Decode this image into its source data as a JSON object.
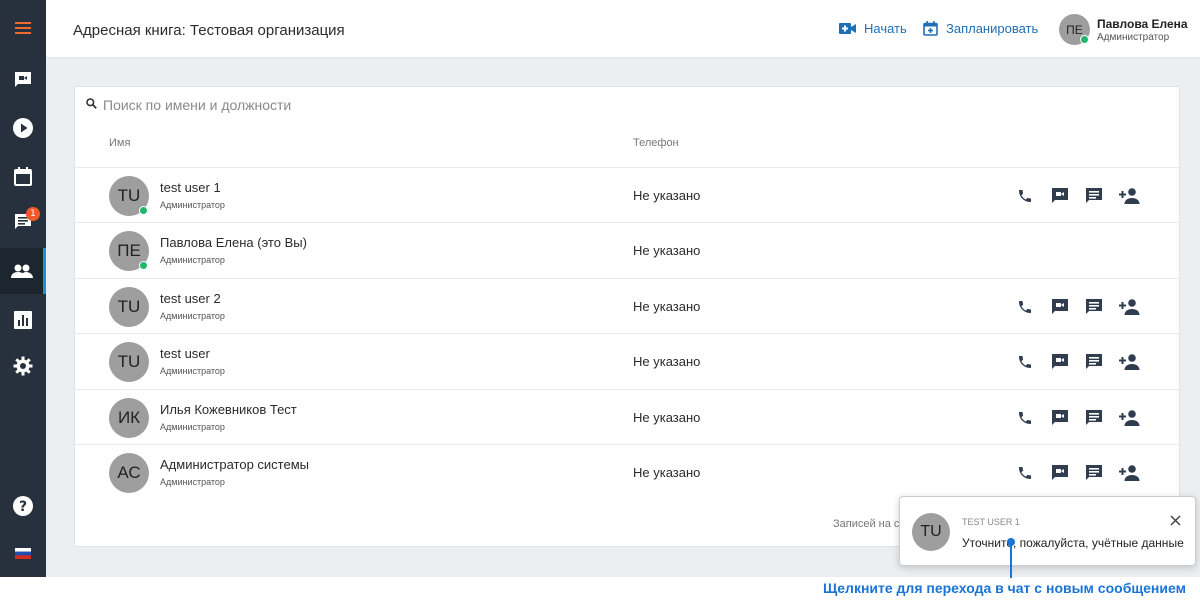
{
  "sidebar": {
    "items": [
      {
        "icon": "menu-icon"
      },
      {
        "icon": "video-chat-icon"
      },
      {
        "icon": "play-icon"
      },
      {
        "icon": "calendar-icon"
      },
      {
        "icon": "chat-icon",
        "badge": "1"
      },
      {
        "icon": "contacts-icon",
        "active": true
      },
      {
        "icon": "stats-icon"
      },
      {
        "icon": "settings-icon"
      },
      {
        "icon": "help-icon"
      },
      {
        "icon": "flag-ru-icon"
      }
    ],
    "accent": "#1d8fe0"
  },
  "header": {
    "title": "Адресная книга: Тестовая организация",
    "start_label": "Начать",
    "schedule_label": "Запланировать",
    "user": {
      "initials": "ПЕ",
      "name": "Павлова Елена",
      "role": "Администратор"
    }
  },
  "search": {
    "placeholder": "Поиск по имени и должности",
    "value": ""
  },
  "table": {
    "columns": {
      "name": "Имя",
      "phone": "Телефон"
    },
    "rows": [
      {
        "initials": "TU",
        "name": "test user 1",
        "role": "Администратор",
        "phone": "Не указано",
        "online": true,
        "actions": true
      },
      {
        "initials": "ПЕ",
        "name": "Павлова Елена (это Вы)",
        "role": "Администратор",
        "phone": "Не указано",
        "online": true,
        "actions": false
      },
      {
        "initials": "TU",
        "name": "test user 2",
        "role": "Администратор",
        "phone": "Не указано",
        "online": false,
        "actions": true
      },
      {
        "initials": "TU",
        "name": "test user",
        "role": "Администратор",
        "phone": "Не указано",
        "online": false,
        "actions": true
      },
      {
        "initials": "ИК",
        "name": "Илья Кожевников Тест",
        "role": "Администратор",
        "phone": "Не указано",
        "online": false,
        "actions": true
      },
      {
        "initials": "АС",
        "name": "Администратор системы",
        "role": "Администратор",
        "phone": "Не указано",
        "online": false,
        "actions": true
      }
    ],
    "footer_text": "Записей на ст"
  },
  "toast": {
    "initials": "TU",
    "sender": "TEST USER 1",
    "message": "Уточните, пожалуйста, учётные данные"
  },
  "annotation": {
    "text": "Щелкните для перехода в чат с новым сообщением"
  },
  "colors": {
    "link": "#1f6fb7",
    "online": "#1fb86a",
    "badge": "#ef5a28",
    "annotation": "#1a73d6"
  }
}
